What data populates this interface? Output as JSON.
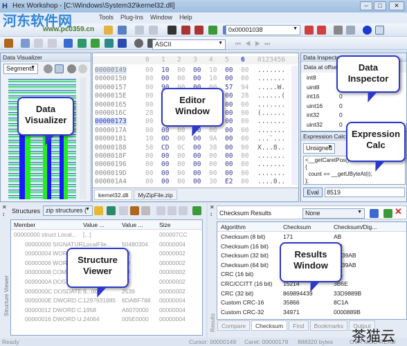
{
  "window": {
    "title": "Hex Workshop - [C:\\Windows\\System32\\kernel32.dll]",
    "minimize": "–",
    "maximize": "□",
    "close": "✕"
  },
  "watermark": {
    "text": "河东软件网",
    "url": "www.pc0359.cn",
    "corner": "茶猫云"
  },
  "menu": [
    "Tools",
    "Plug-Ins",
    "Window",
    "Help"
  ],
  "toolbar": {
    "address": "0x00001038",
    "encoding": "ASCII"
  },
  "visualizer": {
    "title": "Data Visualizer",
    "mode": "Segments",
    "colors": [
      "#1a1aff",
      "#22ee22",
      "#a8d8e8"
    ]
  },
  "editor": {
    "col_headers": [
      "0",
      "1",
      "2",
      "3",
      "4",
      "5",
      "6"
    ],
    "ascii_header": "0123456",
    "rows": [
      {
        "off": "00000149",
        "bytes": [
          "00",
          "10",
          "00",
          "00",
          "10",
          "00",
          "00"
        ],
        "ascii": "......."
      },
      {
        "off": "00000150",
        "bytes": [
          "00",
          "00",
          "00",
          "00",
          "10",
          "00",
          "00"
        ],
        "ascii": "......."
      },
      {
        "off": "00000157",
        "bytes": [
          "00",
          "90",
          "00",
          "00",
          "00",
          "57",
          "94"
        ],
        "ascii": ".....W."
      },
      {
        "off": "0000015E",
        "bytes": [
          "00",
          "00",
          "00",
          "00",
          "00",
          "00",
          "28"
        ],
        "ascii": "......("
      },
      {
        "off": "00000165",
        "bytes": [
          "00",
          "00",
          "00",
          "00",
          "00",
          "00",
          "00"
        ],
        "ascii": "......."
      },
      {
        "off": "0000016C",
        "bytes": [
          "28",
          "00",
          "00",
          "00",
          "00",
          "00",
          "00"
        ],
        "ascii": "(......"
      },
      {
        "off": "00000173",
        "bytes": [
          "00",
          "00",
          "00",
          "00",
          "00",
          "00",
          "00"
        ],
        "ascii": "......."
      },
      {
        "off": "0000017A",
        "bytes": [
          "00",
          "00",
          "00",
          "00",
          "00",
          "00",
          "00"
        ],
        "ascii": "......."
      },
      {
        "off": "00000181",
        "bytes": [
          "10",
          "0D",
          "00",
          "00",
          "9A",
          "00",
          "00"
        ],
        "ascii": "...`..."
      },
      {
        "off": "00000188",
        "bytes": [
          "58",
          "CD",
          "0C",
          "00",
          "38",
          "00",
          "00"
        ],
        "ascii": "X...8.."
      },
      {
        "off": "0000018F",
        "bytes": [
          "00",
          "00",
          "00",
          "00",
          "00",
          "00",
          "00"
        ],
        "ascii": "......."
      },
      {
        "off": "00000196",
        "bytes": [
          "00",
          "00",
          "00",
          "00",
          "00",
          "00",
          "00"
        ],
        "ascii": "......."
      },
      {
        "off": "0000019D",
        "bytes": [
          "00",
          "00",
          "00",
          "00",
          "00",
          "00",
          "00"
        ],
        "ascii": "......."
      },
      {
        "off": "000001A4",
        "bytes": [
          "00",
          "00",
          "00",
          "00",
          "30",
          "E2",
          "00"
        ],
        "ascii": "....0.."
      }
    ],
    "tabs": [
      "kernel32.dll",
      "MyZipFile.zip"
    ]
  },
  "inspector": {
    "title": "Data Inspector",
    "subtitle": "Data at offset",
    "rows": [
      [
        "int8",
        ""
      ],
      [
        "uint8",
        ""
      ],
      [
        "int16",
        "0"
      ],
      [
        "uint16",
        "0"
      ],
      [
        "int32",
        "0"
      ],
      [
        "uint32",
        "0"
      ]
    ]
  },
  "calc": {
    "title": "Expression Calc",
    "mode": "Unsigned",
    "code": [
      "<__getCaretPos()",
      "{",
      "  count += __getUByteAt(i);",
      "};"
    ],
    "eval": "Eval",
    "result": "8519"
  },
  "structures": {
    "title": "Structures",
    "library": "zip structures (",
    "side_label": "Structure Viewer",
    "columns": [
      "Member",
      "Value ...",
      "Value ...",
      "Size"
    ],
    "rows": [
      [
        "00000000 struct Local...",
        "[...]",
        "",
        "000007CC"
      ],
      [
        "00000000 SIGNATUR...",
        "LocalFile...",
        "50480304",
        "00000004"
      ],
      [
        "00000004 WORD ...",
        "",
        "...0",
        "00000002"
      ],
      [
        "00000006 WORD ...",
        "",
        "...0",
        "00000002"
      ],
      [
        "00000008 COMP...",
        "",
        "...0",
        "00000002"
      ],
      [
        "0000000A DOST...",
        "",
        "...F",
        "00000002"
      ],
      [
        "0000000C DOSDATE ...",
        "9...00",
        "2539",
        "00000002"
      ],
      [
        "0000000E DWORD C...",
        "1297931885",
        "6DABF788",
        "00000004"
      ],
      [
        "00000012 DWORD C...",
        "1958",
        "A6070000",
        "00000004"
      ],
      [
        "00000016 DWORD U...",
        "24064",
        "005E0000",
        "00000004"
      ]
    ]
  },
  "results": {
    "title": "Checksum Results",
    "filter": "None",
    "side_label": "Results",
    "columns": [
      "Algorithm",
      "Checksum",
      "Checksum/Dig..."
    ],
    "rows": [
      [
        "Checksum (8 bit)",
        "171",
        "AB"
      ],
      [
        "Checksum (16 bit)",
        "",
        "...B"
      ],
      [
        "Checksum (32 bit)",
        "",
        "...139AB"
      ],
      [
        "Checksum (64 bit)",
        "",
        "...139AB"
      ],
      [
        "CRC (16 bit)",
        "",
        "...A"
      ],
      [
        "CRC/CCITT (16 bit)",
        "15214",
        "3B6E"
      ],
      [
        "CRC (32 bit)",
        "869894439",
        "33D9889B"
      ],
      [
        "Custom CRC-16",
        "35866",
        "8C1A"
      ],
      [
        "Custom CRC-32",
        "34971",
        "0000889B"
      ]
    ],
    "tabs": [
      "Compare",
      "Checksum",
      "Find",
      "Bookmarks",
      "Output"
    ]
  },
  "callouts": {
    "visualizer": "Data Visualizer",
    "editor": "Editor Window",
    "inspector": "Data Inspector",
    "calc": "Expression Calc",
    "structure": "Structure Viewer",
    "results": "Results Window"
  },
  "status": {
    "ready": "Ready",
    "cursor": "Cursor: 00000149",
    "caret": "Caret: 00000179",
    "size": "888320 bytes",
    "flags": "OVR  MOD  READ"
  }
}
